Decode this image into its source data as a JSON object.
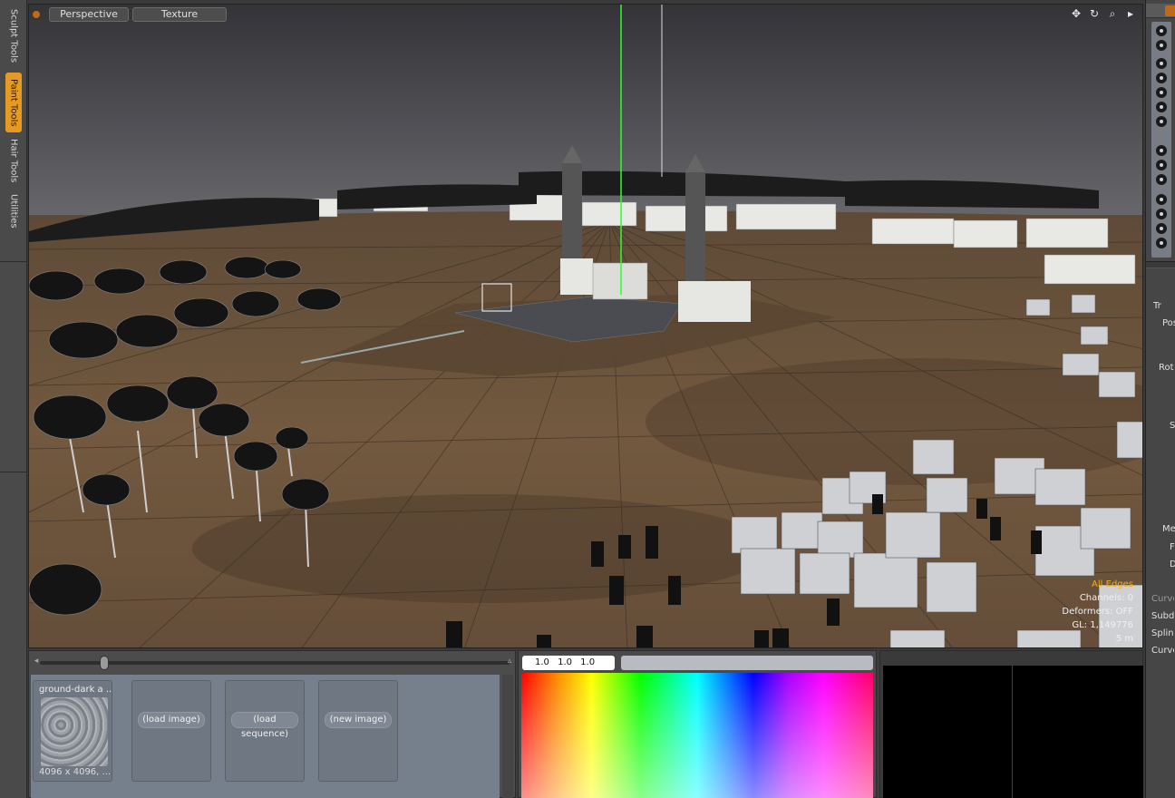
{
  "left_tabs": [
    "Sculpt Tools",
    "Paint Tools",
    "Hair Tools",
    "Utilities"
  ],
  "active_tab": "Paint Tools",
  "viewport": {
    "tabs": [
      "Perspective",
      "Texture"
    ],
    "controls": [
      "move-icon",
      "rotate-icon",
      "zoom-icon",
      "menu-arrow-icon"
    ],
    "hud": {
      "mode": "All Edges",
      "channels": "Channels: 0",
      "deformers": "Deformers: OFF",
      "gl": "GL: 1,149776",
      "scale": "5 m"
    }
  },
  "right_panel": {
    "labels": [
      "Tr",
      "Pos",
      "Rot",
      "S",
      "Me",
      "F",
      "D",
      "Curve",
      "Subdi",
      "Spline",
      "Curve"
    ]
  },
  "image_panel": {
    "cards": [
      {
        "title": "ground-dark a ...",
        "dims": "4096 x 4096, ..."
      },
      {
        "button": "(load image)"
      },
      {
        "button": "(load sequence)"
      },
      {
        "button": "(new image)"
      }
    ]
  },
  "color_panel": {
    "rgb_text": "1.0 1.0 1.0"
  },
  "colors": {
    "accent": "#e59a22",
    "hud_highlight": "#f0b020",
    "panel_bg": "#464646"
  }
}
